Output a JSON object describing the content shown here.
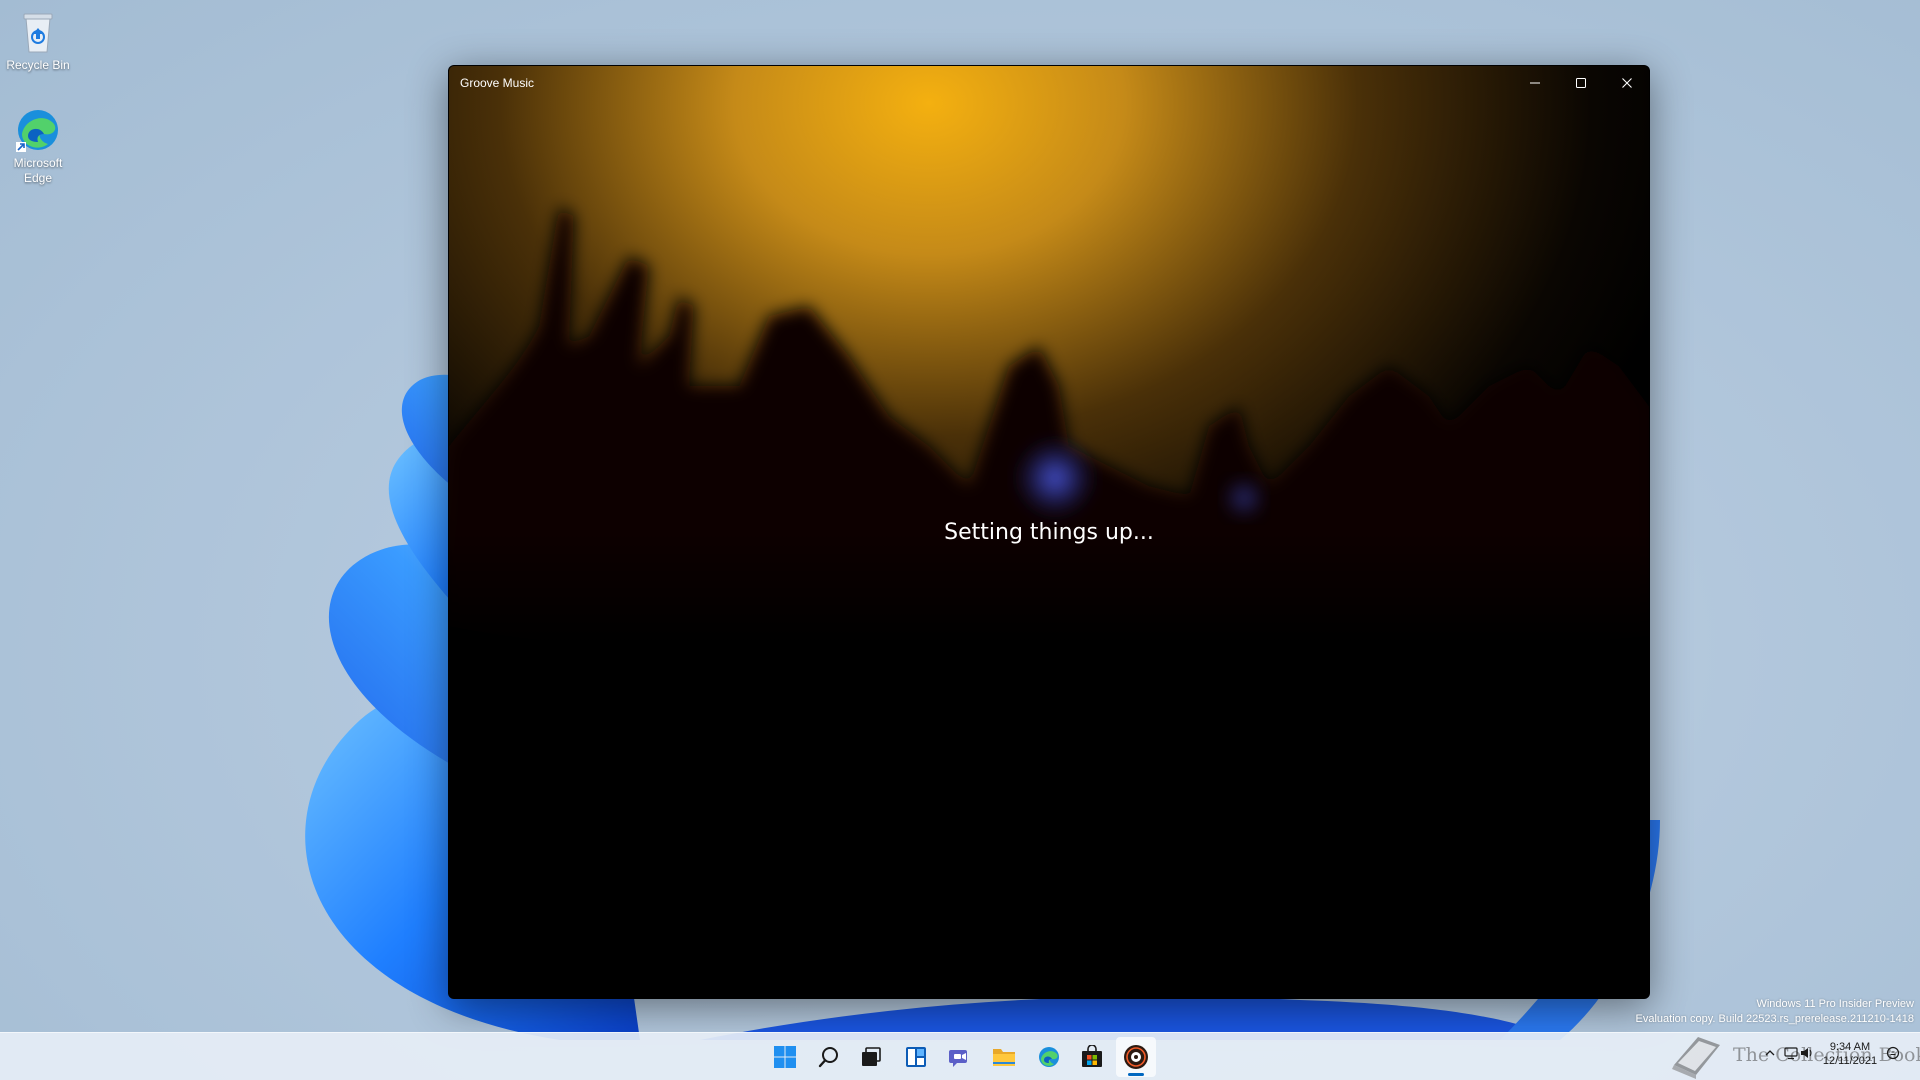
{
  "desktop": {
    "icons": [
      {
        "label": "Recycle Bin",
        "icon": "recycle-bin-icon"
      },
      {
        "label": "Microsoft Edge",
        "icon": "edge-icon"
      }
    ]
  },
  "window": {
    "title": "Groove Music",
    "status": "Setting things up...",
    "controls": {
      "minimize": "minimize-icon",
      "maximize": "maximize-icon",
      "close": "close-icon"
    }
  },
  "watermark": {
    "line1": "Windows 11 Pro Insider Preview",
    "line2": "Evaluation copy. Build 22523.rs_prerelease.211210-1418"
  },
  "taskbar": {
    "apps": [
      {
        "name": "start",
        "icon": "windows-start-icon"
      },
      {
        "name": "search",
        "icon": "search-icon"
      },
      {
        "name": "task-view",
        "icon": "task-view-icon"
      },
      {
        "name": "widgets",
        "icon": "widgets-icon"
      },
      {
        "name": "chat",
        "icon": "chat-icon"
      },
      {
        "name": "file-explorer",
        "icon": "folder-icon"
      },
      {
        "name": "edge",
        "icon": "edge-icon"
      },
      {
        "name": "store",
        "icon": "store-icon"
      },
      {
        "name": "groove-music",
        "icon": "groove-music-icon",
        "active": true
      }
    ],
    "tray": {
      "time": "9:34 AM",
      "date": "12/11/2021"
    }
  },
  "logo_watermark": {
    "text": "The Collection Book"
  },
  "colors": {
    "accent": "#0067c0",
    "window_bg": "#000000",
    "glow": "#e6a100"
  }
}
